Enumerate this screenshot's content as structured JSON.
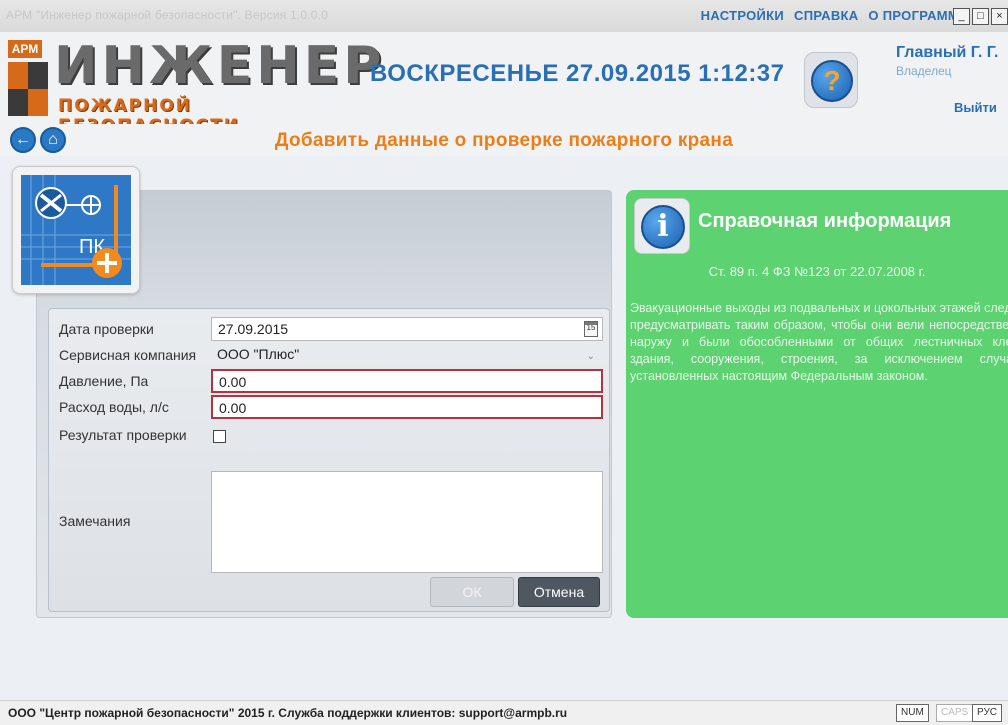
{
  "app": {
    "window_title": "АРМ \"Инженер пожарной безопасности\". Версия 1.0.0.0",
    "menu": [
      "НАСТРОЙКИ",
      "СПРАВКА",
      "О ПРОГРАММЕ"
    ],
    "window_buttons": [
      "_",
      "□",
      "×"
    ]
  },
  "header": {
    "logo_badge": "АРМ",
    "logo_main": "ИНЖЕНЕР",
    "logo_sub": "ПОЖАРНОЙ БЕЗОПАСНОСТИ",
    "datetime": "ВОСКРЕСЕНЬЕ 27.09.2015 1:12:37",
    "help_glyph": "?",
    "user_name": "Главный Г. Г.",
    "user_role": "Владелец",
    "logout_label": "Выйти"
  },
  "nav": {
    "back_glyph": "←",
    "home_glyph": "⌂",
    "page_title": "Добавить данные о проверке пожарного крана"
  },
  "form": {
    "date_label": "Дата проверки",
    "date_value": "27.09.2015",
    "calendar_glyph": "15",
    "company_label": "Сервисная компания",
    "company_value": "ООО \"Плюс\"",
    "pressure_label": "Давление, Па",
    "pressure_value": "0.00",
    "flow_label": "Расход воды, л/с",
    "flow_value": "0.00",
    "result_label": "Результат проверки",
    "result_checked": false,
    "remarks_label": "Замечания",
    "remarks_value": "",
    "ok_label": "ОК",
    "cancel_label": "Отмена"
  },
  "info": {
    "icon_glyph": "i",
    "title": "Справочная информация",
    "reference": "Ст. 89 п. 4 ФЗ №123 от 22.07.2008 г.",
    "text": "Эвакуационные выходы из подвальных и цокольных этажей следует предусматривать таким образом, чтобы они вели непосредственно наружу и были обособленными от общих лестничных клеток здания, сооружения, строения, за исключением случаев, установленных настоящим Федеральным законом."
  },
  "statusbar": {
    "copyright": "ООО \"Центр пожарной безопасности\" 2015 г. Служба поддержки клиентов: support@armpb.ru",
    "num": "NUM",
    "caps": "CAPS",
    "lang": "РУС"
  },
  "colors": {
    "accent_blue": "#2a6fb4",
    "title_orange": "#ee7d16",
    "info_green": "#5cd270",
    "error_border": "#b7323d"
  },
  "icons": {
    "back": "arrow-left-icon",
    "home": "home-icon",
    "help": "help-icon",
    "info": "info-icon",
    "calendar": "calendar-icon",
    "module": "fire-hydrant-module-icon"
  }
}
